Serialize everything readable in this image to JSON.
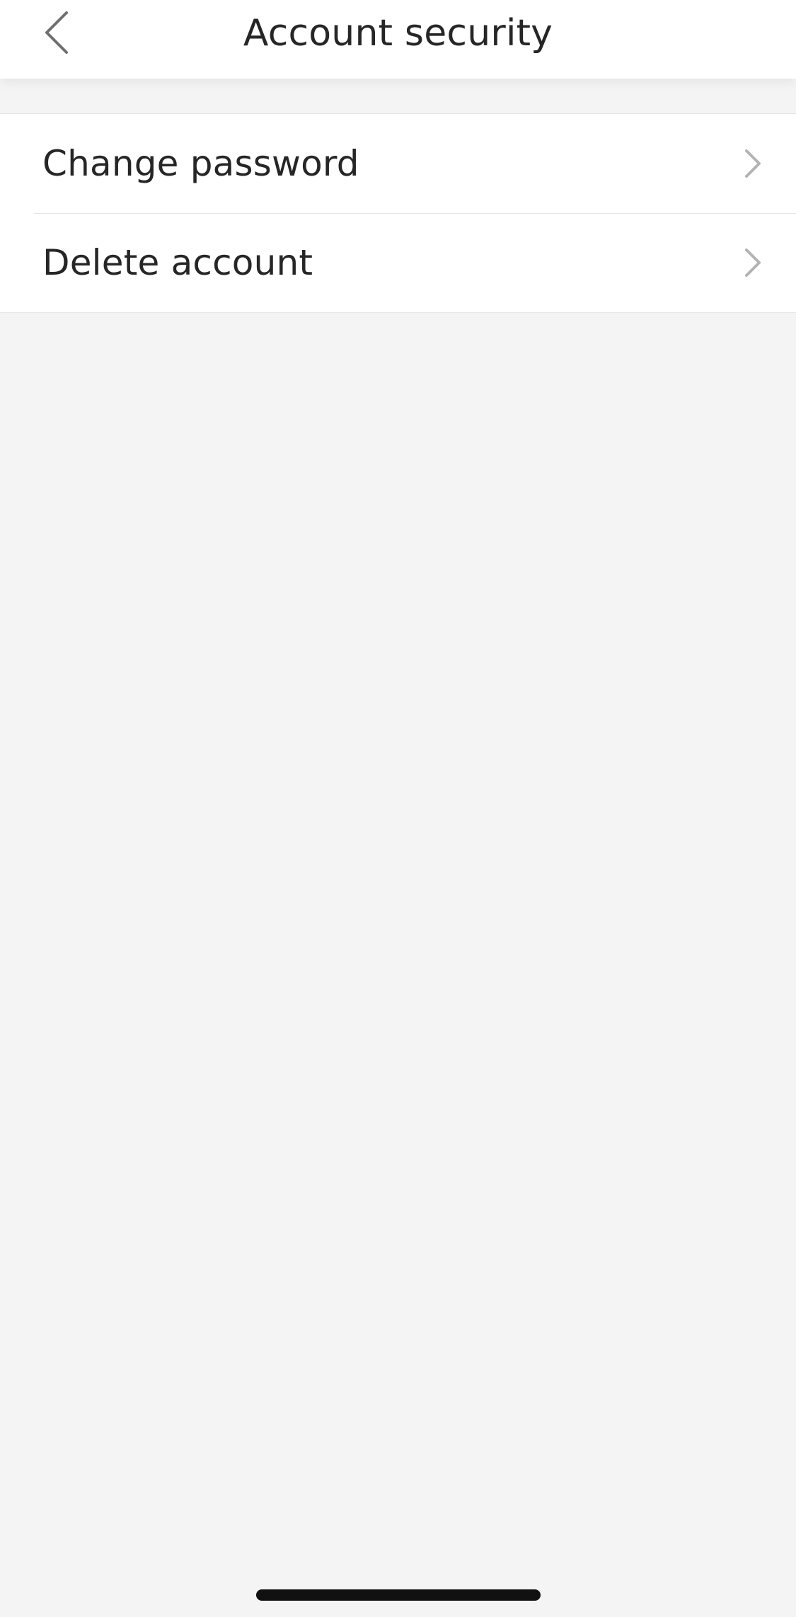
{
  "header": {
    "title": "Account security",
    "back_icon": "chevron-left-icon"
  },
  "menu": {
    "items": [
      {
        "label": "Change password",
        "icon": "chevron-right-icon"
      },
      {
        "label": "Delete account",
        "icon": "chevron-right-icon"
      }
    ]
  },
  "colors": {
    "background": "#f4f4f4",
    "surface": "#ffffff",
    "text": "#262626",
    "chevron": "#b3b3b3",
    "back_icon": "#6f6f6f"
  }
}
